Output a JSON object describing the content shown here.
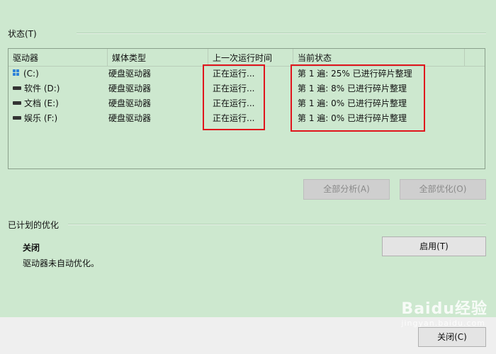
{
  "status_section": {
    "label": "状态(T)"
  },
  "table": {
    "headers": [
      "驱动器",
      "媒体类型",
      "上一次运行时间",
      "当前状态"
    ],
    "rows": [
      {
        "icon": "windows-drive-icon",
        "drive": "(C:)",
        "media": "硬盘驱动器",
        "last_run": "正在运行...",
        "status": "第 1 遍: 25% 已进行碎片整理"
      },
      {
        "icon": "hard-drive-icon",
        "drive": "软件 (D:)",
        "media": "硬盘驱动器",
        "last_run": "正在运行...",
        "status": "第 1 遍: 8% 已进行碎片整理"
      },
      {
        "icon": "hard-drive-icon",
        "drive": "文档 (E:)",
        "media": "硬盘驱动器",
        "last_run": "正在运行...",
        "status": "第 1 遍: 0% 已进行碎片整理"
      },
      {
        "icon": "hard-drive-icon",
        "drive": "娱乐 (F:)",
        "media": "硬盘驱动器",
        "last_run": "正在运行...",
        "status": "第 1 遍: 0% 已进行碎片整理"
      }
    ]
  },
  "actions": {
    "analyze_all": "全部分析(A)",
    "optimize_all": "全部优化(O)"
  },
  "scheduled": {
    "label": "已计划的优化",
    "state": "关闭",
    "description": "驱动器未自动优化。",
    "enable_button": "启用(T)"
  },
  "footer": {
    "close_button": "关闭(C)"
  },
  "watermark": {
    "main": "Baidu经验",
    "sub": "jingyan.baidu.com"
  },
  "colors": {
    "background": "#cde8cf",
    "annotation": "#e0141c",
    "footer": "#efefef"
  }
}
